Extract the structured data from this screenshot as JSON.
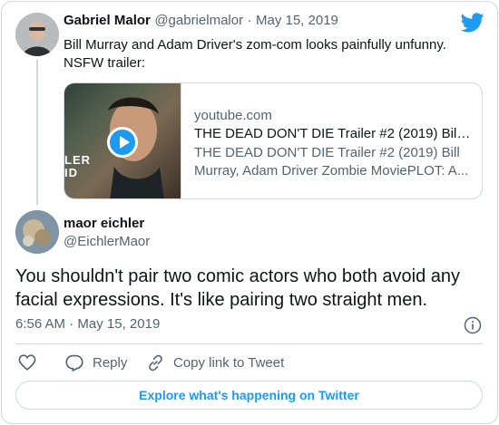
{
  "brand": {
    "accent": "#1d9bf0",
    "text": "#0f1419",
    "muted": "#536471",
    "border": "#cfd9de"
  },
  "original_tweet": {
    "author_name": "Gabriel Malor",
    "handle": "@gabrielmalor",
    "separator": "·",
    "date": "May 15, 2019",
    "text_line1": "Bill Murray and Adam Driver's zom-com looks painfully unfunny.",
    "text_line2": "NSFW trailer:",
    "link_card": {
      "domain": "youtube.com",
      "title": "THE DEAD DON'T DIE Trailer #2 (2019) Bil…",
      "description": "THE DEAD DON'T DIE Trailer #2 (2019) Bill Murray, Adam Driver Zombie MoviePLOT: A...",
      "thumb_text_line1": "LER",
      "thumb_text_line2": "ID"
    }
  },
  "reply": {
    "author_name": "maor eichler",
    "handle": "@EichlerMaor",
    "text": "You shouldn't pair two comic actors who both avoid any facial expressions. It's like pairing two straight men.",
    "time": "6:56 AM",
    "separator": "·",
    "date": "May 15, 2019"
  },
  "actions": {
    "reply_label": "Reply",
    "copy_label": "Copy link to Tweet"
  },
  "explore_label": "Explore what's happening on Twitter",
  "icons": [
    "twitter-logo",
    "play-icon",
    "info-icon",
    "heart-icon",
    "reply-icon",
    "link-icon"
  ]
}
